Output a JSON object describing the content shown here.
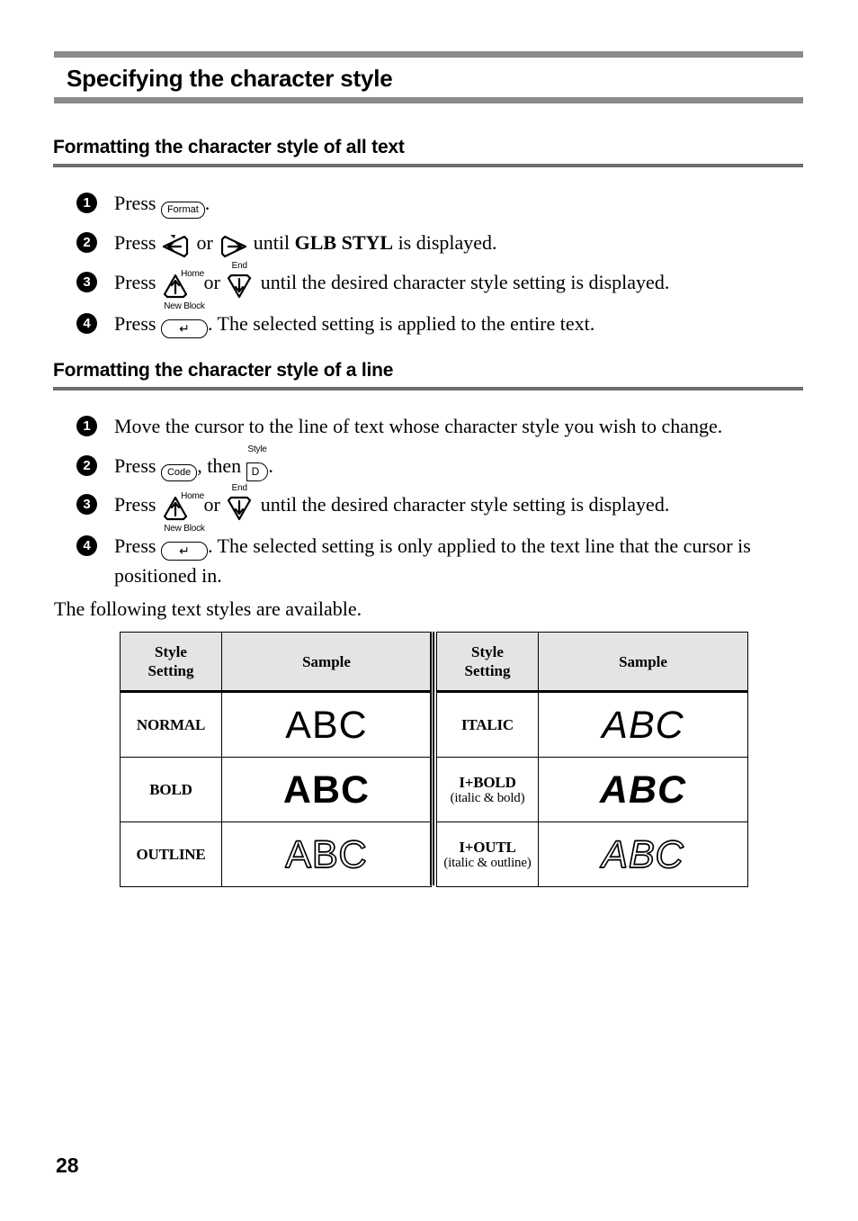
{
  "page": {
    "chapter_title": "Specifying the character style",
    "page_number": "28",
    "accent_rule_color": "#8a8a8a"
  },
  "sections": [
    {
      "id": "all-text",
      "heading": "Formatting the character style of all text",
      "steps": [
        {
          "number": "1",
          "text_before": "Press ",
          "keys": [
            {
              "type": "round",
              "label": "Format"
            }
          ],
          "text_after": "."
        },
        {
          "number": "2",
          "text_before": "Press ",
          "keys": [
            {
              "type": "triangle-left",
              "label": "",
              "glyph": "left-arrow-key"
            },
            {
              "type": "triangle-right",
              "label": "",
              "glyph": "right-arrow-key"
            }
          ],
          "joiner": " or ",
          "text_after": " until ",
          "bold_text": "GLB STYL",
          "text_end": " is displayed."
        },
        {
          "number": "3",
          "text_before": "Press ",
          "keys": [
            {
              "type": "triangle-up",
              "label": "Home"
            },
            {
              "type": "triangle-down",
              "label": "End"
            }
          ],
          "joiner": " or ",
          "text_after": " until the desired character style setting is displayed."
        },
        {
          "number": "4",
          "text_before": "Press ",
          "keys": [
            {
              "type": "enter",
              "label": "New Block"
            }
          ],
          "text_after": ". The selected setting is applied to the entire text."
        }
      ]
    },
    {
      "id": "a-line",
      "heading": "Formatting the character style of a line",
      "steps": [
        {
          "number": "1",
          "text_only": "Move the cursor to the line of text whose character style you wish to change."
        },
        {
          "number": "2",
          "text_before": "Press ",
          "keys": [
            {
              "type": "round",
              "label": "Code"
            },
            {
              "type": "dkey",
              "label": "Style",
              "cap": "D"
            }
          ],
          "joiner": ", then ",
          "text_after": "."
        },
        {
          "number": "3",
          "text_before": "Press ",
          "keys": [
            {
              "type": "triangle-up",
              "label": "Home"
            },
            {
              "type": "triangle-down",
              "label": "End"
            }
          ],
          "joiner": " or ",
          "text_after": " until the desired character style setting is displayed."
        },
        {
          "number": "4",
          "text_before": "Press ",
          "keys": [
            {
              "type": "enter",
              "label": "New Block"
            }
          ],
          "text_after": ". The selected setting is only applied to the text line that the cursor is positioned in."
        }
      ]
    }
  ],
  "intro_paragraph": "The following text styles are available.",
  "style_table": {
    "headers": {
      "setting_line1": "Style",
      "setting_line2": "Setting",
      "sample": "Sample"
    },
    "rows": [
      {
        "left_setting": "NORMAL",
        "left_setting_sub": "",
        "left_sample": "ABC",
        "left_style": "normal",
        "right_setting": "ITALIC",
        "right_setting_sub": "",
        "right_sample": "ABC",
        "right_style": "italic"
      },
      {
        "left_setting": "BOLD",
        "left_setting_sub": "",
        "left_sample": "ABC",
        "left_style": "bold",
        "right_setting": "I+BOLD",
        "right_setting_sub": "(italic & bold)",
        "right_sample": "ABC",
        "right_style": "italic-bold"
      },
      {
        "left_setting": "OUTLINE",
        "left_setting_sub": "",
        "left_sample": "ABC",
        "left_style": "outline",
        "right_setting": "I+OUTL",
        "right_setting_sub": "(italic & outline)",
        "right_sample": "ABC",
        "right_style": "italic-outline"
      }
    ]
  }
}
